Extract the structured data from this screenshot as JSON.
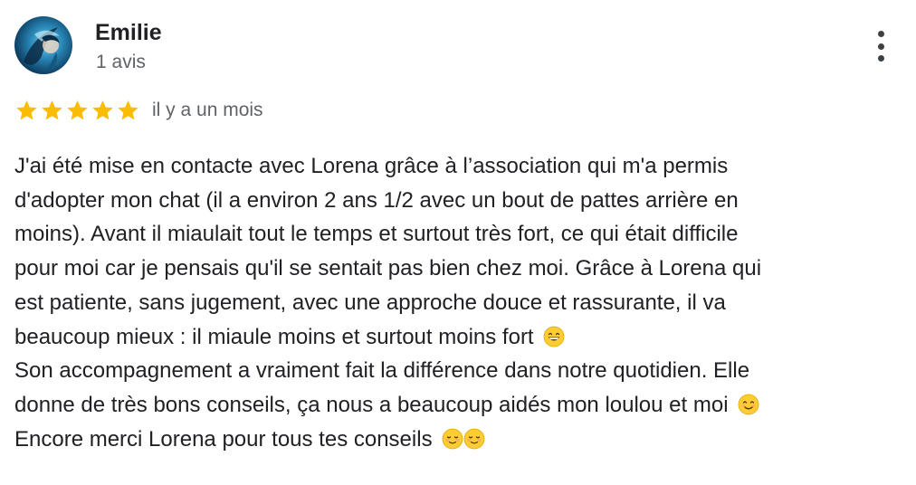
{
  "review": {
    "author": {
      "name": "Emilie",
      "review_count": "1 avis"
    },
    "rating": 5,
    "date": "il y a un mois",
    "text_lines": [
      "J'ai été mise en contacte avec Lorena grâce à l’association qui m'a permis",
      "d'adopter mon chat (il a environ 2 ans 1/2 avec un bout de pattes arrière en",
      "moins). Avant il miaulait tout le temps et surtout très fort, ce qui était difficile",
      "pour moi car je pensais qu'il se sentait pas bien chez moi. Grâce à Lorena qui",
      "est patiente, sans jugement, avec une approche douce et rassurante, il va",
      "beaucoup mieux : il miaule moins et surtout moins fort",
      "Son accompagnement a vraiment fait la différence dans notre quotidien. Elle",
      "donne de très bons conseils, ça nous a beaucoup aidés mon loulou et moi",
      "Encore merci Lorena pour tous tes conseils"
    ],
    "emojis": {
      "line6": "grinning-face-with-smiling-eyes",
      "line8": "smiling-face-with-smiling-eyes",
      "line9": "smiling-face"
    }
  },
  "colors": {
    "star": "#fbbc04",
    "text": "#202124",
    "secondary": "#5f6368"
  },
  "icons": {
    "menu": "more-vert-icon",
    "star": "star-icon"
  }
}
